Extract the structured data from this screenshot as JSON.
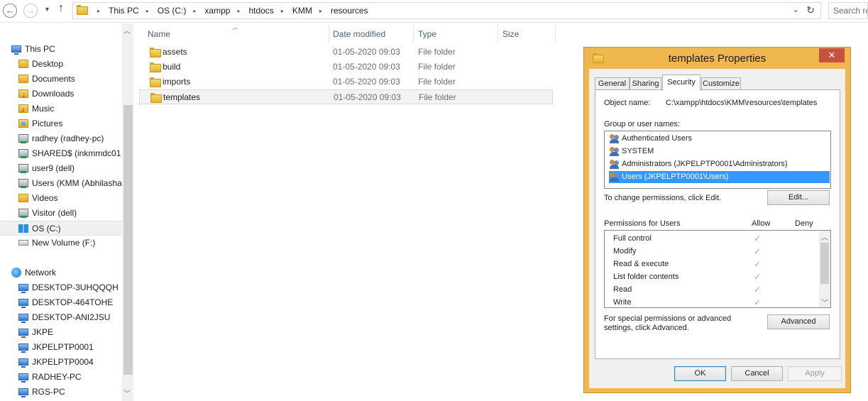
{
  "address": {
    "crumbs": [
      "This PC",
      "OS (C:)",
      "xampp",
      "htdocs",
      "KMM",
      "resources"
    ],
    "search_placeholder": "Search re"
  },
  "nav": {
    "items": [
      {
        "label": "This PC",
        "icon": "computer-icon",
        "level": "root"
      },
      {
        "label": "Desktop",
        "icon": "folder-icon",
        "level": "child"
      },
      {
        "label": "Documents",
        "icon": "folder-icon",
        "level": "child"
      },
      {
        "label": "Downloads",
        "icon": "downloads-folder-icon",
        "level": "child"
      },
      {
        "label": "Music",
        "icon": "music-folder-icon",
        "level": "child"
      },
      {
        "label": "Pictures",
        "icon": "pictures-folder-icon",
        "level": "child"
      },
      {
        "label": "radhey (radhey-pc)",
        "icon": "network-share-icon",
        "level": "child"
      },
      {
        "label": "SHARED$ (inkmmdc01",
        "icon": "network-share-icon",
        "level": "child"
      },
      {
        "label": "user9 (dell)",
        "icon": "network-share-icon",
        "level": "child"
      },
      {
        "label": "Users (KMM (Abhilasha)",
        "icon": "network-share-icon",
        "level": "child"
      },
      {
        "label": "Videos",
        "icon": "folder-icon",
        "level": "child"
      },
      {
        "label": "Visitor (dell)",
        "icon": "network-share-icon",
        "level": "child"
      },
      {
        "label": "OS (C:)",
        "icon": "windows-drive-icon",
        "level": "child",
        "selected": true
      },
      {
        "label": "New Volume (F:)",
        "icon": "drive-icon",
        "level": "child"
      },
      {
        "gap": true
      },
      {
        "label": "Network",
        "icon": "network-icon",
        "level": "root"
      },
      {
        "label": "DESKTOP-3UHQQQH",
        "icon": "computer-icon",
        "level": "child"
      },
      {
        "label": "DESKTOP-464TOHE",
        "icon": "computer-icon",
        "level": "child"
      },
      {
        "label": "DESKTOP-ANI2JSU",
        "icon": "computer-icon",
        "level": "child"
      },
      {
        "label": "JKPE",
        "icon": "computer-icon",
        "level": "child"
      },
      {
        "label": "JKPELPTP0001",
        "icon": "computer-icon",
        "level": "child"
      },
      {
        "label": "JKPELPTP0004",
        "icon": "computer-icon",
        "level": "child"
      },
      {
        "label": "RADHEY-PC",
        "icon": "computer-icon",
        "level": "child"
      },
      {
        "label": "RGS-PC",
        "icon": "computer-icon",
        "level": "child"
      }
    ]
  },
  "files": {
    "columns": {
      "name": "Name",
      "date": "Date modified",
      "type": "Type",
      "size": "Size"
    },
    "rows": [
      {
        "name": "assets",
        "date": "01-05-2020 09:03",
        "type": "File folder",
        "selected": false
      },
      {
        "name": "build",
        "date": "01-05-2020 09:03",
        "type": "File folder",
        "selected": false
      },
      {
        "name": "imports",
        "date": "01-05-2020 09:03",
        "type": "File folder",
        "selected": false
      },
      {
        "name": "templates",
        "date": "01-05-2020 09:03",
        "type": "File folder",
        "selected": true
      }
    ]
  },
  "dialog": {
    "title": "templates Properties",
    "close_glyph": "✕",
    "tabs": [
      "General",
      "Sharing",
      "Security",
      "Customize"
    ],
    "active_tab": "Security",
    "object_name_label": "Object name:",
    "object_name_value": "C:\\xampp\\htdocs\\KMM\\resources\\templates",
    "group_label": "Group or user names:",
    "users": [
      {
        "name": "Authenticated Users",
        "selected": false
      },
      {
        "name": "SYSTEM",
        "selected": false
      },
      {
        "name": "Administrators (JKPELPTP0001\\Administrators)",
        "selected": false
      },
      {
        "name": "Users (JKPELPTP0001\\Users)",
        "selected": true
      }
    ],
    "change_text": "To change permissions, click Edit.",
    "edit_label": "Edit...",
    "permissions_label": "Permissions for Users",
    "allow_label": "Allow",
    "deny_label": "Deny",
    "permissions": [
      {
        "name": "Full control",
        "allow": true
      },
      {
        "name": "Modify",
        "allow": true
      },
      {
        "name": "Read & execute",
        "allow": true
      },
      {
        "name": "List folder contents",
        "allow": true
      },
      {
        "name": "Read",
        "allow": true
      },
      {
        "name": "Write",
        "allow": true
      }
    ],
    "special_text": "For special permissions or advanced settings, click Advanced.",
    "advanced_label": "Advanced",
    "ok_label": "OK",
    "cancel_label": "Cancel",
    "apply_label": "Apply"
  },
  "colors": {
    "dialog_frame": "#f0b74e",
    "selection": "#3399ff",
    "close_button": "#c7503f"
  }
}
